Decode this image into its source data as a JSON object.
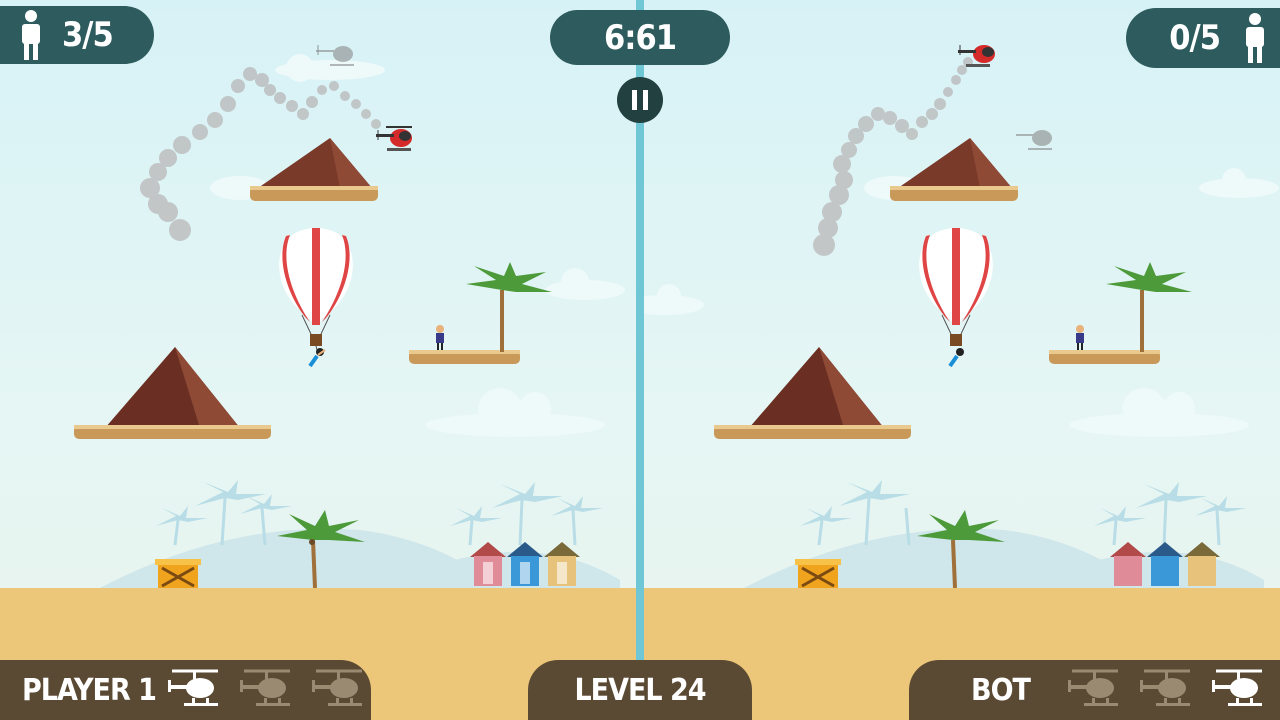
{
  "hud": {
    "player_rescued": "3/5",
    "bot_rescued": "0/5",
    "timer": "6:61",
    "level": "LEVEL 24",
    "player_label": "PLAYER 1",
    "bot_label": "BOT",
    "player_lives_remaining": 1,
    "player_lives_total": 3,
    "bot_lives_remaining": 1,
    "bot_lives_total": 3
  },
  "icons": {
    "person": "person-icon",
    "pause": "pause-icon",
    "helicopter": "helicopter-icon",
    "balloon": "hot-air-balloon",
    "palm": "palm-tree",
    "volcano": "volcano",
    "crate": "wooden-crate",
    "hut": "beach-hut"
  },
  "colors": {
    "hud_bg": "#2e5c5e",
    "hud_bottom_bg": "#5b4a33",
    "sand": "#ecc77a",
    "sky": "#d7f2f6",
    "divider": "#6fc7d6",
    "helicopter_active": "#d42a2a",
    "volcano": "#7a3a2a"
  }
}
